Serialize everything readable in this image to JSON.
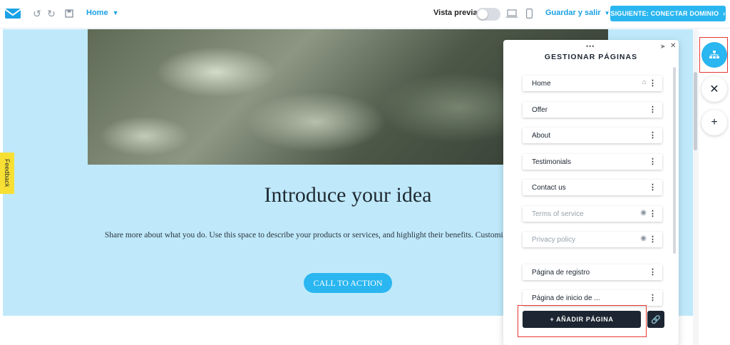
{
  "topbar": {
    "home_label": "Home",
    "preview_label": "Vista previa",
    "save_label": "Guardar y salir",
    "next_label": "SIGUIENTE: CONECTAR DOMINIO"
  },
  "canvas": {
    "title": "Introduce your idea",
    "text": "Share more about what you do. Use this space to describe your products or services, and highlight their benefits. Customize the drive your point home.",
    "cta": "CALL TO ACTION",
    "feedback": "Feedback"
  },
  "panel": {
    "title": "GESTIONAR PÁGINAS",
    "pages": [
      {
        "label": "Home",
        "icon": "home-icon"
      },
      {
        "label": "Offer"
      },
      {
        "label": "About"
      },
      {
        "label": "Testimonials"
      },
      {
        "label": "Contact us"
      },
      {
        "label": "Terms of service",
        "icon": "eye-icon",
        "hidden": true
      },
      {
        "label": "Privacy policy",
        "icon": "eye-icon",
        "hidden": true
      },
      {
        "label": "Página de registro"
      },
      {
        "label": "Página de inicio de ..."
      }
    ],
    "add_label": "+ AÑADIR PÁGINA"
  },
  "colors": {
    "accent": "#2ab6f0",
    "dark": "#1c2531",
    "canvas_bg": "#bfe9fa",
    "highlight": "#e53935"
  }
}
